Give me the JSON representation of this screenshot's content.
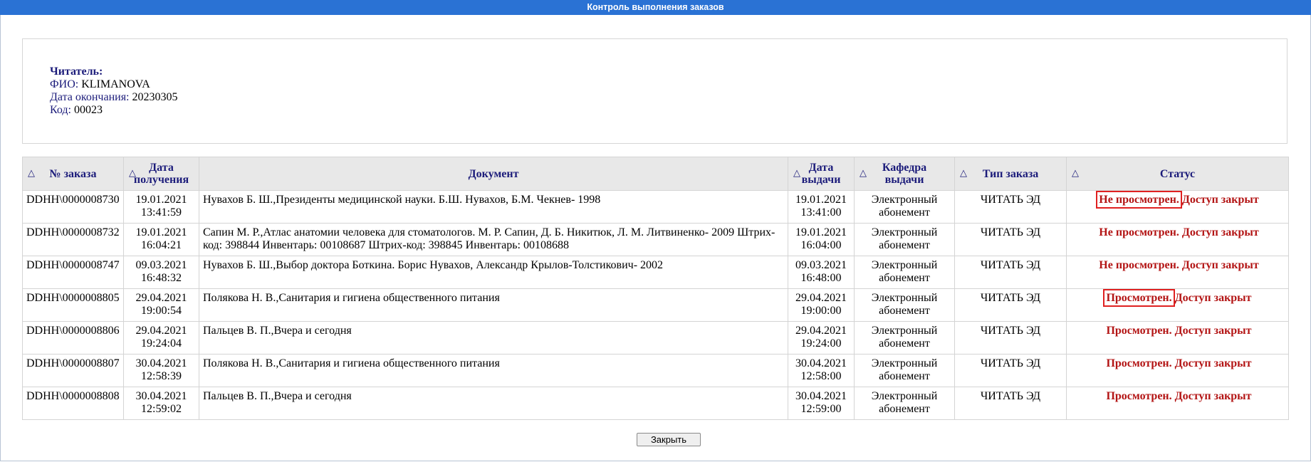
{
  "window": {
    "title": "Контроль выполнения заказов"
  },
  "reader": {
    "header": "Читатель:",
    "fio_label": "ФИО:",
    "fio_value": "KLIMANOVA",
    "end_date_label": "Дата окончания:",
    "end_date_value": "20230305",
    "code_label": "Код:",
    "code_value": "00023"
  },
  "table": {
    "sort_glyph": "△",
    "headers": {
      "order_no": "№ заказа",
      "received_line1": "Дата",
      "received_line2": "получения",
      "document": "Документ",
      "issued_line1": "Дата",
      "issued_line2": "выдачи",
      "dept_line1": "Кафедра",
      "dept_line2": "выдачи",
      "type": "Тип заказа",
      "status": "Статус"
    },
    "rows": [
      {
        "order_no": "DDHH\\0000008730",
        "recv_date": "19.01.2021",
        "recv_time": "13:41:59",
        "document": "Нувахов Б. Ш.,Президенты медицинской науки. Б.Ш. Нувахов, Б.М. Чекнев- 1998",
        "issue_date": "19.01.2021",
        "issue_time": "13:41:00",
        "dept_line1": "Электронный",
        "dept_line2": "абонемент",
        "type": "ЧИТАТЬ ЭД",
        "status_viewed": "Не просмотрен.",
        "status_access": "Доступ закрыт"
      },
      {
        "order_no": "DDHH\\0000008732",
        "recv_date": "19.01.2021",
        "recv_time": "16:04:21",
        "document": "Сапин М. Р.,Атлас анатомии человека для стоматологов. М. Р. Сапин, Д. Б. Никитюк, Л. М. Литвиненко- 2009 Штрих-код: 398844 Инвентарь: 00108687 Штрих-код: 398845 Инвентарь: 00108688",
        "issue_date": "19.01.2021",
        "issue_time": "16:04:00",
        "dept_line1": "Электронный",
        "dept_line2": "абонемент",
        "type": "ЧИТАТЬ ЭД",
        "status_viewed": "Не просмотрен.",
        "status_access": "Доступ закрыт"
      },
      {
        "order_no": "DDHH\\0000008747",
        "recv_date": "09.03.2021",
        "recv_time": "16:48:32",
        "document": "Нувахов Б. Ш.,Выбор доктора Боткина. Борис Нувахов, Александр Крылов-Толстикович- 2002",
        "issue_date": "09.03.2021",
        "issue_time": "16:48:00",
        "dept_line1": "Электронный",
        "dept_line2": "абонемент",
        "type": "ЧИТАТЬ ЭД",
        "status_viewed": "Не просмотрен.",
        "status_access": "Доступ закрыт"
      },
      {
        "order_no": "DDHH\\0000008805",
        "recv_date": "29.04.2021",
        "recv_time": "19:00:54",
        "document": "Полякова Н. В.,Санитария и гигиена общественного питания",
        "issue_date": "29.04.2021",
        "issue_time": "19:00:00",
        "dept_line1": "Электронный",
        "dept_line2": "абонемент",
        "type": "ЧИТАТЬ ЭД",
        "status_viewed": "Просмотрен.",
        "status_access": "Доступ закрыт"
      },
      {
        "order_no": "DDHH\\0000008806",
        "recv_date": "29.04.2021",
        "recv_time": "19:24:04",
        "document": "Пальцев В. П.,Вчера и сегодня",
        "issue_date": "29.04.2021",
        "issue_time": "19:24:00",
        "dept_line1": "Электронный",
        "dept_line2": "абонемент",
        "type": "ЧИТАТЬ ЭД",
        "status_viewed": "Просмотрен.",
        "status_access": "Доступ закрыт"
      },
      {
        "order_no": "DDHH\\0000008807",
        "recv_date": "30.04.2021",
        "recv_time": "12:58:39",
        "document": "Полякова Н. В.,Санитария и гигиена общественного питания",
        "issue_date": "30.04.2021",
        "issue_time": "12:58:00",
        "dept_line1": "Электронный",
        "dept_line2": "абонемент",
        "type": "ЧИТАТЬ ЭД",
        "status_viewed": "Просмотрен.",
        "status_access": "Доступ закрыт"
      },
      {
        "order_no": "DDHH\\0000008808",
        "recv_date": "30.04.2021",
        "recv_time": "12:59:02",
        "document": "Пальцев В. П.,Вчера и сегодня",
        "issue_date": "30.04.2021",
        "issue_time": "12:59:00",
        "dept_line1": "Электронный",
        "dept_line2": "абонемент",
        "type": "ЧИТАТЬ ЭД",
        "status_viewed": "Просмотрен.",
        "status_access": "Доступ закрыт"
      }
    ]
  },
  "footer": {
    "close_label": "Закрыть"
  },
  "colors": {
    "titlebar": "#2a72d4",
    "status_text": "#b31414",
    "highlight_box": "#e02020",
    "header_text": "#1b1b7a"
  }
}
